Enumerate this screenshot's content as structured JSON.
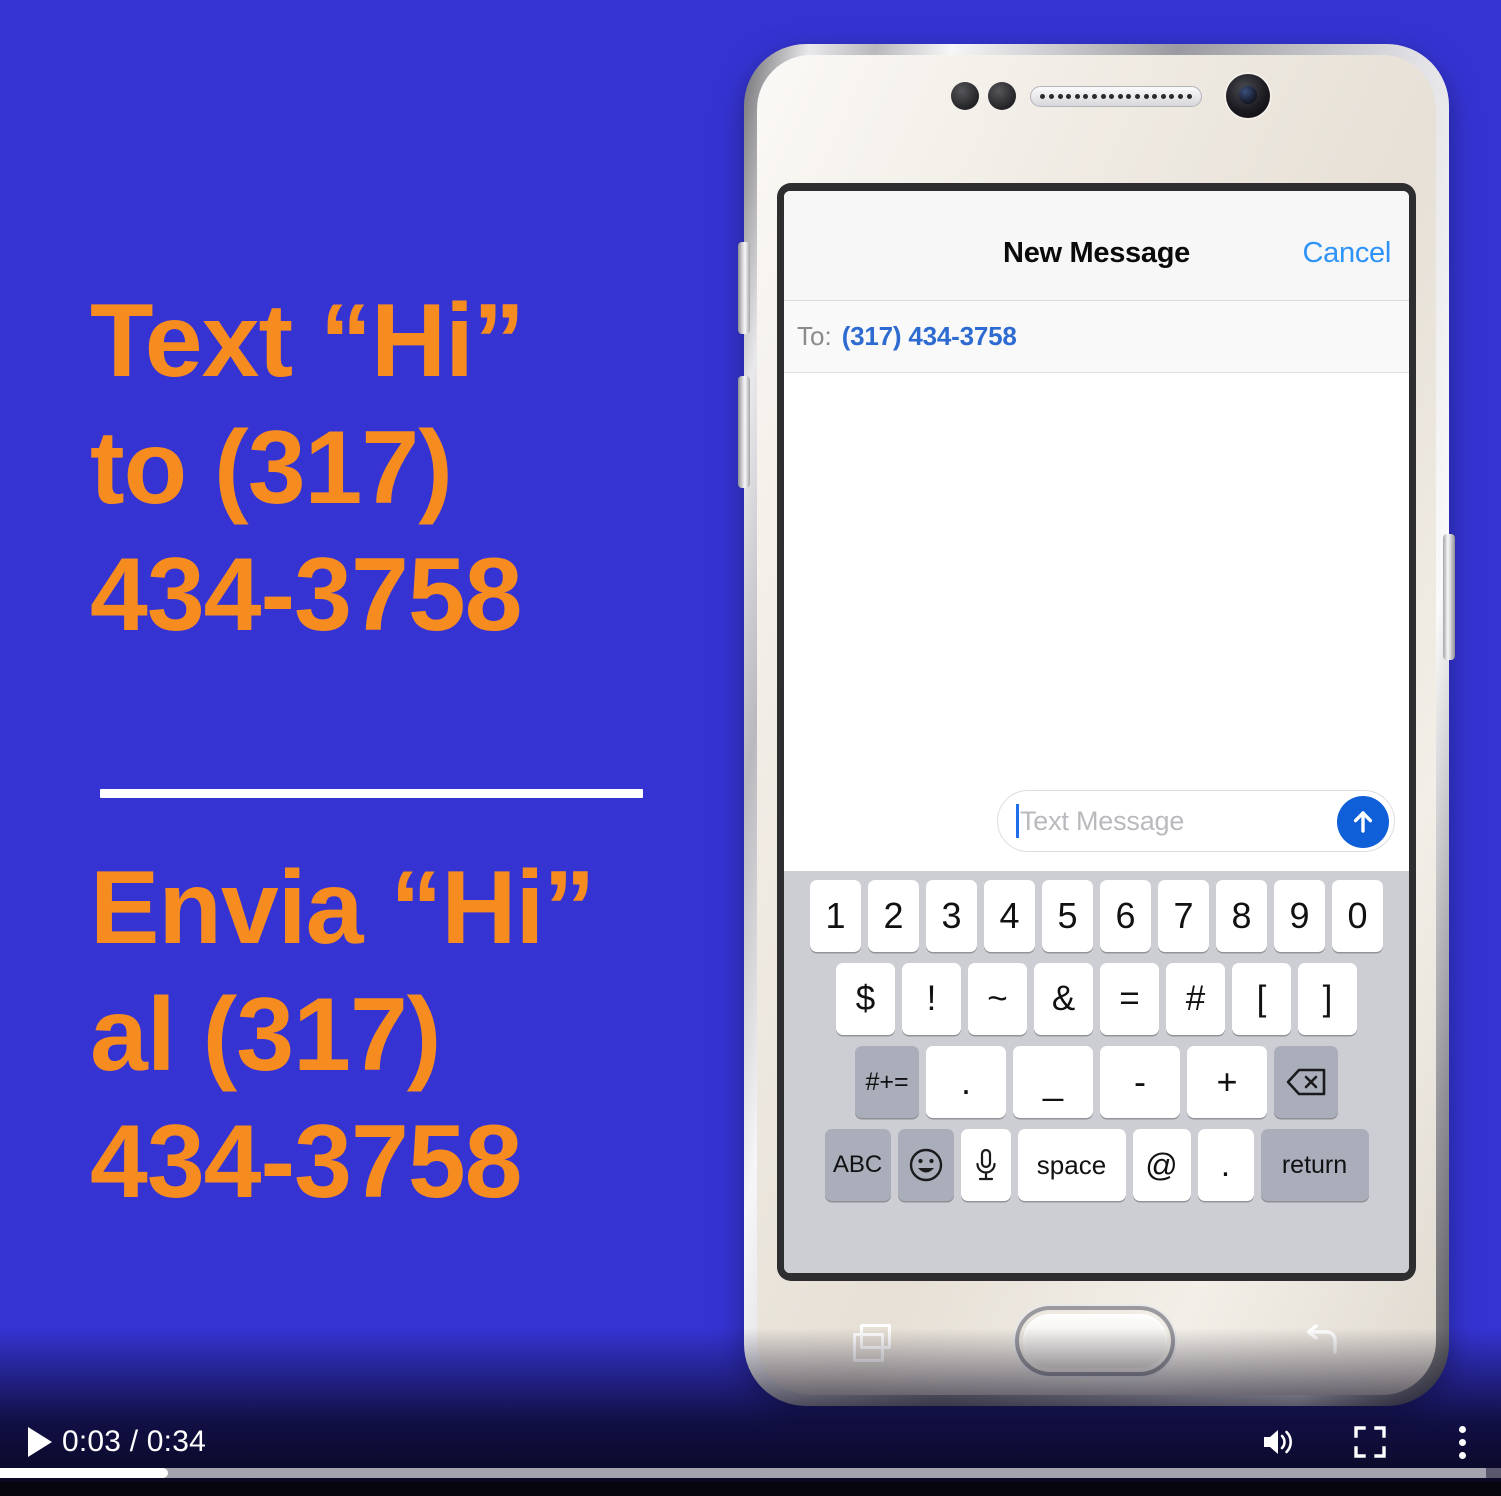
{
  "theme": {
    "bg_blue": "#3534D3",
    "accent_orange": "#F68B1F",
    "ios_blue": "#2E93F7",
    "send_blue": "#0E5FD8"
  },
  "promo": {
    "english": [
      "Text “Hi”",
      "to (317)",
      "434-3758"
    ],
    "spanish": [
      "Envia “Hi”",
      "al (317)",
      "434-3758"
    ]
  },
  "phone": {
    "messages_app": {
      "title": "New Message",
      "cancel_label": "Cancel",
      "to_label": "To:",
      "to_value": "(317) 434-3758",
      "compose_placeholder": "Text Message",
      "send_icon": "send-arrow-up-icon"
    },
    "keyboard": {
      "row1": [
        "1",
        "2",
        "3",
        "4",
        "5",
        "6",
        "7",
        "8",
        "9",
        "0"
      ],
      "row2": [
        "$",
        "!",
        "~",
        "&",
        "=",
        "#",
        "[",
        "]"
      ],
      "row3_mod": "#+=",
      "row3": [
        ".",
        "_",
        "-",
        "+"
      ],
      "row3_backspace": "backspace-icon",
      "row4": {
        "abc": "ABC",
        "emoji": "☺",
        "mic": "microphone-icon",
        "space": "space",
        "at": "@",
        "period": ".",
        "return": "return"
      }
    },
    "nav": {
      "recents": "recents-icon",
      "home": "home-button",
      "back": "back-icon"
    },
    "hardware": {
      "earpiece_dots": 18
    }
  },
  "video_controls": {
    "play_label": "play-icon",
    "time": "0:03 / 0:34",
    "current_time": "0:03",
    "duration": "0:34",
    "progress_percent": 11.2,
    "volume_icon": "volume-icon",
    "fullscreen_icon": "fullscreen-icon",
    "more_icon": "more-options-icon"
  }
}
